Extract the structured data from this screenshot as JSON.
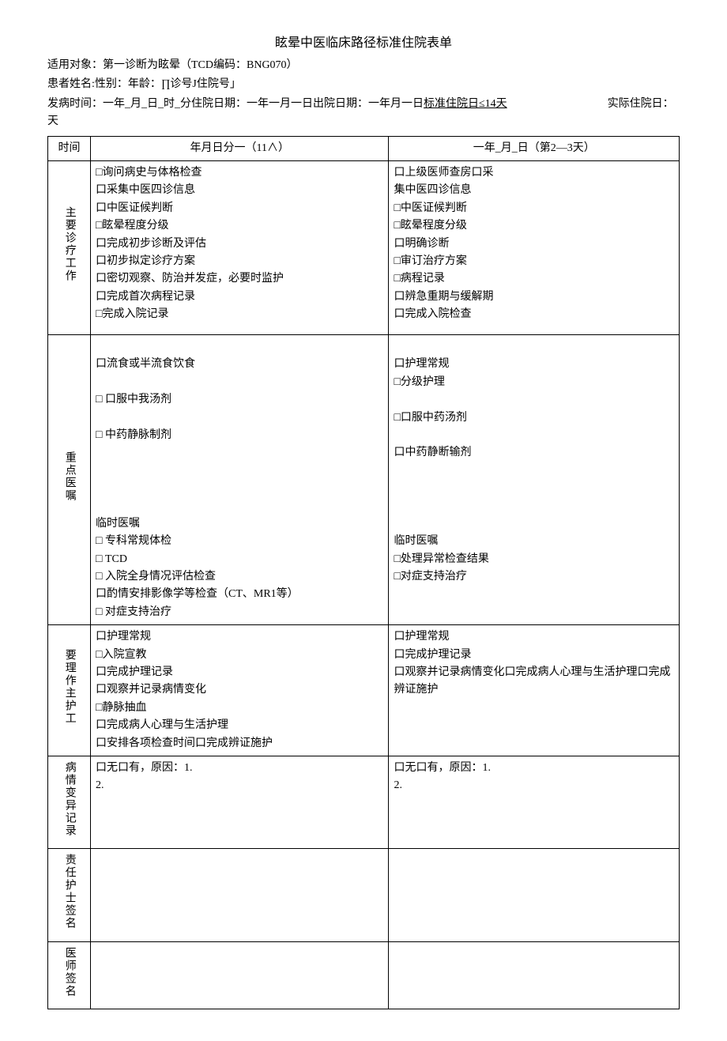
{
  "title": "眩晕中医临床路径标准住院表单",
  "header": {
    "line1": "适用对象：第一诊断为眩晕（TCD编码：BNG070）",
    "line2": "患者姓名:性别：年龄：∏诊号J住院号」",
    "line3a": "发病时间：一年_月_日_时_分住院日期：一年一月一日出院日期：一年月一日",
    "line3b_label": "标准住院日≤14天",
    "line3b_right": "实际住院日：   天"
  },
  "columns": {
    "time_label": "时间",
    "col1_header": "年月日分一（11∧）",
    "col2_header": "一年_月_日（第2—3天）"
  },
  "rows": {
    "main_work": {
      "label": "主要诊疗工作",
      "col1": "□询问病史与体格检查\n口采集中医四诊信息\n口中医证候判断\n□眩晕程度分级\n口完成初步诊断及评估\n口初步拟定诊疗方案\n口密切观察、防治并发症，必要时监护\n口完成首次病程记录\n□完成入院记录\n",
      "col2": "口上级医师查房口采\n集中医四诊信息\n□中医证候判断\n□眩晕程度分级\n口明确诊断\n□审订治疗方案\n□病程记录\n口辨急重期与缓解期\n口完成入院检查"
    },
    "orders": {
      "label": "重点医嘱",
      "col1": "\n口流食或半流食饮食\n\n□ 口服中我汤剂\n\n□ 中药静脉制剂\n\n\n\n\n临时医嘱\n□ 专科常规体检\n□ TCD\n□ 入院全身情况评估检查\n口酌情安排影像学等检查（CT、MR1等）\n□ 对症支持治疗\n",
      "col2": "\n口护理常规\n□分级护理\n\n□口服中药汤剂\n\n口中药静断输剂\n\n\n\n\n临时医嘱\n□处理异常检查结果\n□对症支持治疗"
    },
    "nursing": {
      "label": "要理作主护工",
      "col1": "口护理常规\n□入院宣教\n口完成护理记录\n口观察并记录病情变化\n□静脉抽血\n口完成病人心理与生活护理\n口安排各项检查时间口完成辨证施护",
      "col2": "口护理常规\n口完成护理记录\n口观察并记录病情变化口完成病人心理与生活护理口完成辨证施护"
    },
    "variance": {
      "label": "病情变异记录",
      "col1": "口无口有，原因：1.\n2.",
      "col2": "口无口有，原因：1.\n2."
    },
    "nurse_sign": {
      "label": "责任护士签名",
      "col1": "",
      "col2": ""
    },
    "doctor_sign": {
      "label": "医师签名",
      "col1": "",
      "col2": ""
    }
  }
}
